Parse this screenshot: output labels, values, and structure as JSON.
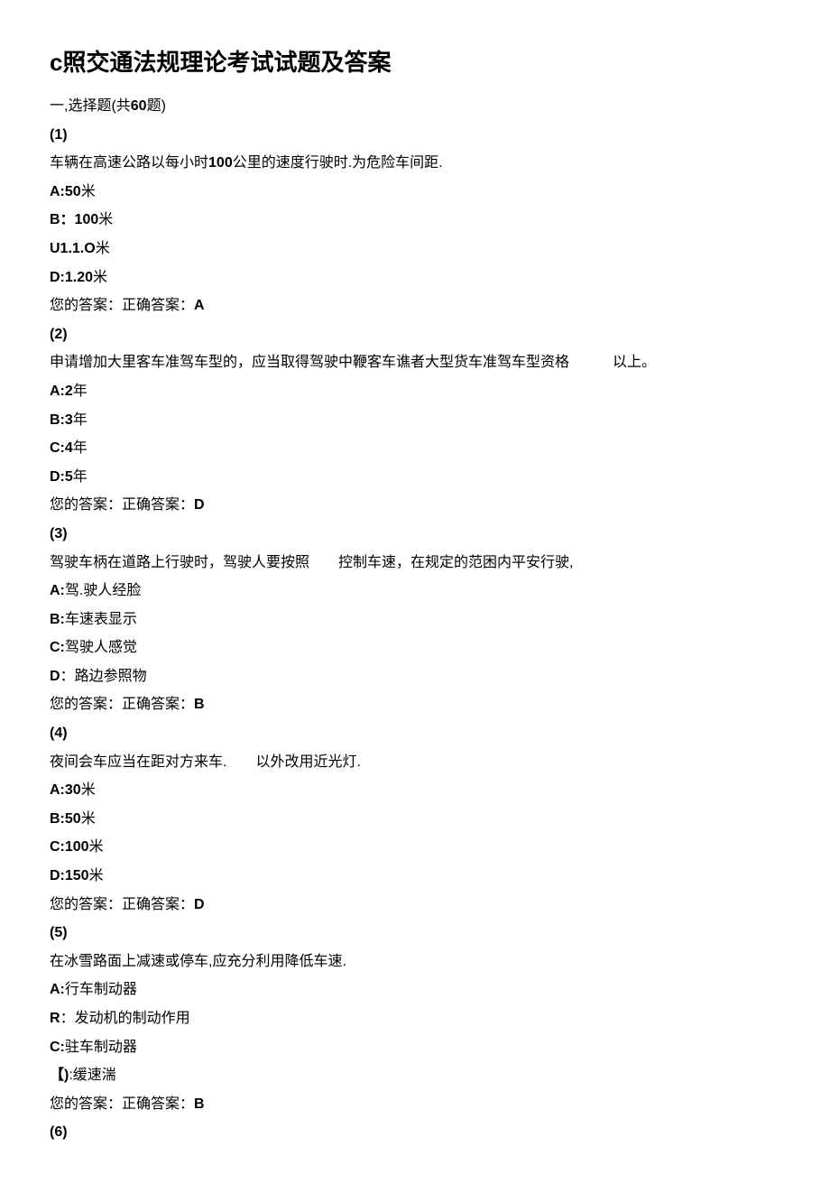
{
  "title": "c照交通法规理论考试试题及答案",
  "section_intro_prefix": "一,选择题(共",
  "section_count": "60",
  "section_intro_suffix": "题)",
  "your_answer_label": "您的答案：正确答案：",
  "questions": [
    {
      "num": "(1)",
      "text_prefix": "车辆在高速公路以每小时",
      "text_bold": "100",
      "text_suffix": "公里的速度行驶时.为危险车间距.",
      "optA_label": "A:50",
      "optA_suffix": "米",
      "optB_label": "B：100",
      "optB_suffix": "米",
      "optC_label": "U1.1.O",
      "optC_suffix": "米",
      "optD_label": "D:1.20",
      "optD_suffix": "米",
      "correct": "A"
    },
    {
      "num": "(2)",
      "text": "申请增加大里客车准驾车型的，应当取得驾驶中鞭客车谯者大型货车准驾车型资格   以上。",
      "optA_label": "A:2",
      "optA_suffix": "年",
      "optB_label": "B:3",
      "optB_suffix": "年",
      "optC_label": "C:4",
      "optC_suffix": "年",
      "optD_label": "D:5",
      "optD_suffix": "年",
      "correct": "D"
    },
    {
      "num": "(3)",
      "text": "驾驶车柄在道路上行驶时，驾驶人要按照  控制车速，在规定的范困内平安行驶,",
      "optA_label": "A:",
      "optA_suffix": "驾.驶人经脸",
      "optB_label": "B:",
      "optB_suffix": "车速表显示",
      "optC_label": "C:",
      "optC_suffix": "驾驶人感觉",
      "optD_label": "D",
      "optD_suffix": "：路边参照物",
      "correct": "B"
    },
    {
      "num": "(4)",
      "text": "夜间会车应当在距对方来车.  以外改用近光灯.",
      "optA_label": "A:30",
      "optA_suffix": "米",
      "optB_label": "B:50",
      "optB_suffix": "米",
      "optC_label": "C:100",
      "optC_suffix": "米",
      "optD_label": "D:150",
      "optD_suffix": "米",
      "correct": "D"
    },
    {
      "num": "(5)",
      "text": "在冰雪路面上减速或停车,应充分利用降低车速.",
      "optA_label": "A:",
      "optA_suffix": "行车制动器",
      "optB_label": "R",
      "optB_suffix": "：发动机的制动作用",
      "optC_label": "C:",
      "optC_suffix": "驻车制动器",
      "optD_label": "【)",
      "optD_suffix": ":缓速湍",
      "correct": "B"
    },
    {
      "num": "(6)"
    }
  ]
}
